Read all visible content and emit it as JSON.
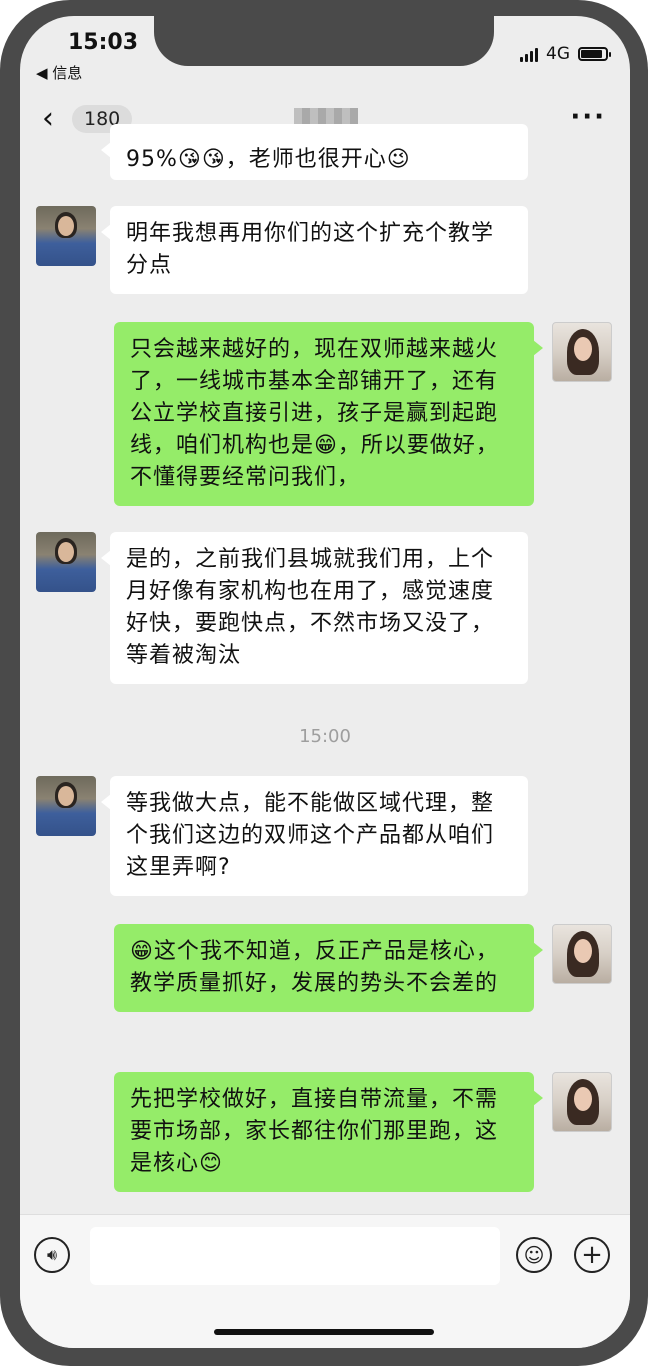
{
  "status_bar": {
    "time": "15:03",
    "back_app": "◀ 信息",
    "network": "4G"
  },
  "nav": {
    "back_icon": "chevron-left-icon",
    "unread_count": "180",
    "more_icon": "more-dots-icon"
  },
  "messages": [
    {
      "side": "in",
      "text": "95%😘😘，老师也很开心😉"
    },
    {
      "side": "in",
      "text": "明年我想再用你们的这个扩充个教学分点"
    },
    {
      "side": "out",
      "text": "只会越来越好的，现在双师越来越火了，一线城市基本全部铺开了，还有公立学校直接引进，孩子是赢到起跑线，咱们机构也是😁，所以要做好，不懂得要经常问我们，"
    },
    {
      "side": "in",
      "text": "是的，之前我们县城就我们用，上个月好像有家机构也在用了，感觉速度好快，要跑快点，不然市场又没了，等着被淘汰"
    },
    {
      "side": "in",
      "text": "等我做大点，能不能做区域代理，整个我们这边的双师这个产品都从咱们这里弄啊?"
    },
    {
      "side": "out",
      "text": "😁这个我不知道，反正产品是核心，教学质量抓好，发展的势头不会差的"
    },
    {
      "side": "out",
      "text": "先把学校做好，直接自带流量，不需要市场部，家长都往你们那里跑，这是核心😊"
    }
  ],
  "timestamp": "15:00",
  "input_bar": {
    "voice_icon": "voice-icon",
    "emoji_icon": "emoji-icon",
    "plus_icon": "plus-icon"
  }
}
